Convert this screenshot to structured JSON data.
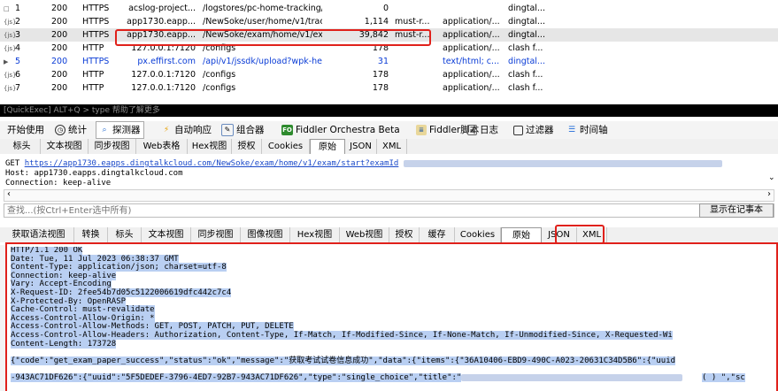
{
  "sessions": [
    {
      "id": "1",
      "icon": "□",
      "result": "200",
      "protocol": "HTTPS",
      "host": "acslog-project...",
      "url": "/logstores/pc-home-tracking/track?...",
      "body": "0",
      "caching": "",
      "content_type": "",
      "process": "dingtal...",
      "style": "normal"
    },
    {
      "id": "2",
      "icon": "{js}",
      "result": "200",
      "protocol": "HTTPS",
      "host": "app1730.eapp...",
      "url": "/NewSoke/user/home/v1/tracking?...",
      "body": "1,114",
      "caching": "must-r...",
      "content_type": "application/...",
      "process": "dingtal...",
      "style": "normal"
    },
    {
      "id": "3",
      "icon": "{js}",
      "result": "200",
      "protocol": "HTTPS",
      "host": "app1730.eapp...",
      "url": "/NewSoke/exam/home/v1/exam/st...",
      "body": "39,842",
      "caching": "must-r...",
      "content_type": "application/...",
      "process": "dingtal...",
      "style": "selected"
    },
    {
      "id": "4",
      "icon": "{js}",
      "result": "200",
      "protocol": "HTTP",
      "host": "127.0.0.1:7120",
      "url": "/configs",
      "body": "178",
      "caching": "",
      "content_type": "application/...",
      "process": "clash f...",
      "style": "normal"
    },
    {
      "id": "5",
      "icon": "▶",
      "result": "200",
      "protocol": "HTTPS",
      "host": "px.effirst.com",
      "url": "/api/v1/jssdk/upload?wpk-header=...",
      "body": "31",
      "caching": "",
      "content_type": "text/html; c...",
      "process": "dingtal...",
      "style": "blue"
    },
    {
      "id": "6",
      "icon": "{js}",
      "result": "200",
      "protocol": "HTTP",
      "host": "127.0.0.1:7120",
      "url": "/configs",
      "body": "178",
      "caching": "",
      "content_type": "application/...",
      "process": "clash f...",
      "style": "normal"
    },
    {
      "id": "7",
      "icon": "{js}",
      "result": "200",
      "protocol": "HTTP",
      "host": "127.0.0.1:7120",
      "url": "/configs",
      "body": "178",
      "caching": "",
      "content_type": "application/...",
      "process": "clash f...",
      "style": "normal"
    }
  ],
  "quickexec": {
    "text": "[QuickExec] ALT+Q > type 帮助了解更多"
  },
  "toolbar": {
    "get_started": "开始使用",
    "statistics": "统计",
    "inspectors": "探测器",
    "autoresponder": "自动响应",
    "composer": "组合器",
    "orchestra_icon": "FO",
    "orchestra": "Fiddler Orchestra Beta",
    "script": "Fiddler脚本",
    "log": "日志",
    "filters": "过滤器",
    "timeline": "时间轴"
  },
  "request_tabs": [
    "标头",
    "文本视图",
    "同步视图",
    "Web表格",
    "Hex视图",
    "授权",
    "Cookies",
    "原始",
    "JSON",
    "XML"
  ],
  "request_active": "原始",
  "request": {
    "line1_prefix": "GET ",
    "line1_url": "https://app1730.eapps.dingtalkcloud.com/NewSoke/exam/home/v1/exam/start?examId",
    "line2": "Host: app1730.eapps.dingtalkcloud.com",
    "line3": "Connection: keep-alive"
  },
  "find": {
    "placeholder": "查找...(按Ctrl+Enter选中所有)",
    "button": "显示在记事本"
  },
  "response_tabs": [
    "获取语法视图",
    "转换",
    "标头",
    "文本视图",
    "同步视图",
    "图像视图",
    "Hex视图",
    "Web视图",
    "授权",
    "缓存",
    "Cookies",
    "原始",
    "JSON",
    "XML"
  ],
  "response_active": "原始",
  "response": {
    "headers": [
      "HTTP/1.1 200 OK",
      "Date: Tue, 11 Jul 2023 06:38:37 GMT",
      "Content-Type: application/json; charset=utf-8",
      "Connection: keep-alive",
      "Vary: Accept-Encoding",
      "X-Request-ID: 2fee54b7d05c5122006619dfc442c7c4",
      "X-Protected-By: OpenRASP",
      "Cache-Control: must-revalidate",
      "Access-Control-Allow-Origin: *",
      "Access-Control-Allow-Methods: GET, POST, PATCH, PUT, DELETE",
      "Access-Control-Allow-Headers: Authorization, Content-Type, If-Match, If-Modified-Since, If-None-Match, If-Unmodified-Since, X-Requested-Wi",
      "Content-Length: 173728"
    ],
    "body_line1": "{\"code\":\"get_exam_paper_success\",\"status\":\"ok\",\"message\":\"获取考试试卷信息成功\",\"data\":{\"items\":{\"36A10406-EBD9-490C-A023-20631C34D5B6\":{\"uuid",
    "body_line2_a": "-943AC71DF626\":{\"uuid\":\"5F5DEDEF-3796-4ED7-92B7-943AC71DF626\",\"type\":\"single_choice\",\"title\":\"",
    "body_line2_b": "( ) \",\"sc"
  }
}
